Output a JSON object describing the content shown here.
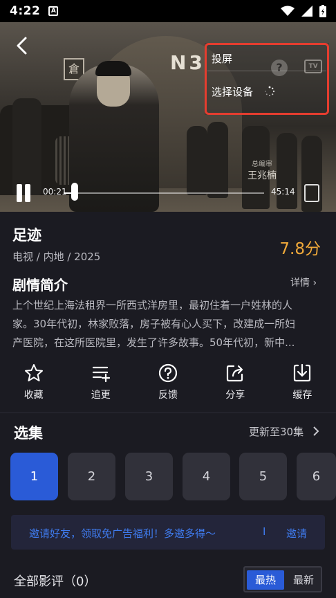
{
  "status_bar": {
    "time": "4:22",
    "notif_glyph": "A"
  },
  "player": {
    "sign_text": "倉",
    "building_number": "N3",
    "credit_role": "总编审",
    "credit_name": "王兆楠",
    "time_current": "00:21",
    "time_total": "45:14",
    "progress_fraction": 0.007
  },
  "cast_menu": {
    "title": "投屏",
    "select_device": "选择设备",
    "help_glyph": "?",
    "tv_glyph": "TV"
  },
  "show": {
    "title": "足迹",
    "meta": "电视 / 内地 / 2025",
    "score": "7.8分"
  },
  "synopsis": {
    "heading": "剧情简介",
    "detail_link": "详情 ›",
    "lines": [
      "上个世纪上海法租界一所西式洋房里，最初住着一户姓林的人",
      "家。30年代初，林家败落，房子被有心人买下，改建成一所妇",
      "产医院，在这所医院里，发生了许多故事。50年代初，新中..."
    ]
  },
  "actions": [
    {
      "label": "收藏",
      "icon": "star-icon"
    },
    {
      "label": "追更",
      "icon": "playlist-add-icon"
    },
    {
      "label": "反馈",
      "icon": "help-circle-icon"
    },
    {
      "label": "分享",
      "icon": "share-icon"
    },
    {
      "label": "缓存",
      "icon": "download-icon"
    }
  ],
  "episodes": {
    "heading": "选集",
    "update": "更新至30集",
    "items": [
      "1",
      "2",
      "3",
      "4",
      "5",
      "6"
    ],
    "selected": "1"
  },
  "invite": {
    "text": "邀请好友，领取免广告福利！多邀多得～",
    "separator": "I",
    "button": "邀请"
  },
  "reviews": {
    "heading": "全部影评（0）",
    "sort_hot": "最热",
    "sort_new": "最新"
  },
  "colors": {
    "accent": "#2a5bd7",
    "score": "#f0a93a",
    "cast_highlight": "#e53d2f",
    "invite_text": "#3f7cf0"
  }
}
